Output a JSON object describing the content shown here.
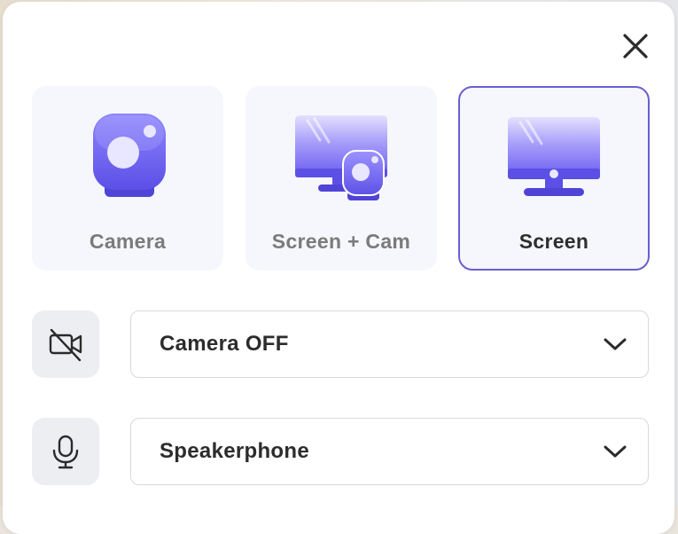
{
  "modes": [
    {
      "label": "Camera",
      "icon": "camera-mode-icon",
      "selected": false
    },
    {
      "label": "Screen + Cam",
      "icon": "screen-cam-mode-icon",
      "selected": false
    },
    {
      "label": "Screen",
      "icon": "screen-mode-icon",
      "selected": true
    }
  ],
  "camera": {
    "value": "Camera OFF",
    "icon": "camera-off-icon"
  },
  "microphone": {
    "value": "Speakerphone",
    "icon": "microphone-icon"
  },
  "colors": {
    "accent": "#6a5fd0",
    "illustration_purple": "#6b5ff0",
    "card_background": "#f6f7fc",
    "icon_tile_background": "#eceef1"
  }
}
